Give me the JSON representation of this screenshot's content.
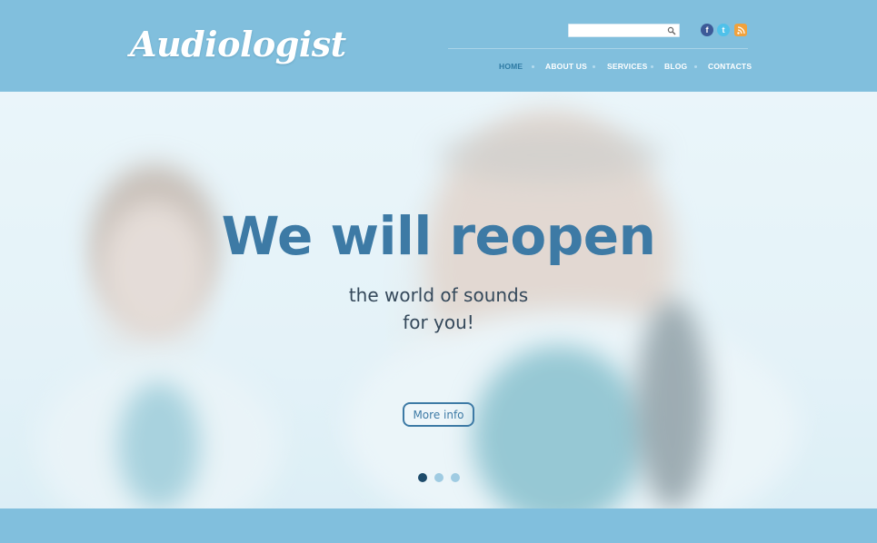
{
  "header": {
    "logo": "Audiologist",
    "search": {
      "placeholder": ""
    },
    "social": [
      {
        "name": "facebook-icon",
        "glyph": "f",
        "color": "#3c5a98"
      },
      {
        "name": "twitter-icon",
        "glyph": "t",
        "color": "#4fc1ea"
      },
      {
        "name": "rss-icon",
        "glyph": ")",
        "color": "#f1a23d"
      }
    ],
    "nav": [
      {
        "label": "HOME",
        "active": true
      },
      {
        "label": "ABOUT US",
        "active": false
      },
      {
        "label": "SERVICES",
        "active": false
      },
      {
        "label": "BLOG",
        "active": false
      },
      {
        "label": "CONTACTS",
        "active": false
      }
    ]
  },
  "hero": {
    "title": "We will reopen",
    "subtitle_line1": "the world of sounds",
    "subtitle_line2": "for you!",
    "button": "More info",
    "slides_total": 3,
    "active_slide": 1
  },
  "colors": {
    "header_bg": "#81bfdd",
    "accent": "#3d7aa5",
    "active_nav": "#2e7aa3"
  }
}
